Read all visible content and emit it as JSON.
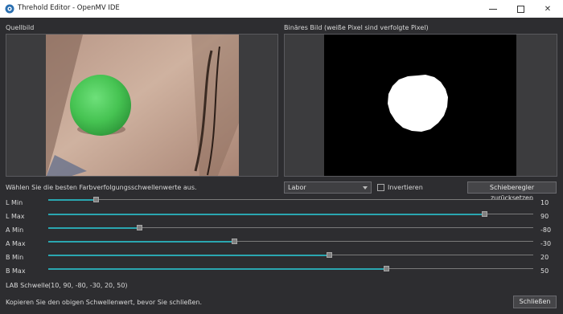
{
  "window": {
    "title": "Threhold Editor - OpenMV IDE",
    "minimize_glyph": "",
    "maximize_glyph": "",
    "close_glyph": "✕"
  },
  "source": {
    "label": "Quellbild"
  },
  "binary": {
    "label": "Binäres Bild (weiße Pixel sind verfolgte Pixel)"
  },
  "instruction": "Wählen Sie die besten Farbverfolgungsschwellenwerte aus.",
  "colorspace": {
    "selected": "Labor"
  },
  "invert": {
    "label": "Invertieren",
    "checked": false
  },
  "reset_button": "Schieberegler zurücksetzen",
  "sliders": [
    {
      "label": "L Min",
      "value": "10",
      "min": 0,
      "max": 100
    },
    {
      "label": "L Max",
      "value": "90",
      "min": 0,
      "max": 100
    },
    {
      "label": "A Min",
      "value": "-80",
      "min": -128,
      "max": 127
    },
    {
      "label": "A Max",
      "value": "-30",
      "min": -128,
      "max": 127
    },
    {
      "label": "B Min",
      "value": "20",
      "min": -128,
      "max": 127
    },
    {
      "label": "B Max",
      "value": "50",
      "min": -128,
      "max": 127
    }
  ],
  "lab_threshold": {
    "label": "LAB Schwelle",
    "value": "(10, 90, -80, -30, 20, 50)"
  },
  "footer": {
    "note": "Kopieren Sie den obigen Schwellenwert, bevor Sie schließen.",
    "close_button": "Schließen"
  },
  "colors": {
    "background": "#2d2d30",
    "accent": "#2aa6b0",
    "ball": "#4cc456",
    "binary_bg": "#000000",
    "binary_fg": "#ffffff"
  },
  "icons": {
    "app": "openmv-logo-icon",
    "dropdown": "chevron-down-icon"
  }
}
